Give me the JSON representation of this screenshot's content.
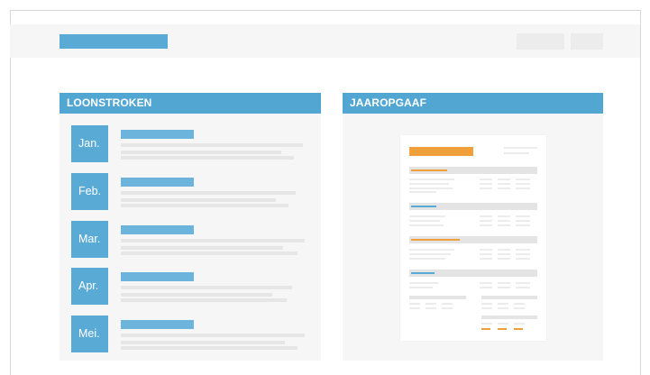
{
  "window": {
    "title": ""
  },
  "colors": {
    "accent": "#52a6d2",
    "doc_highlight": "#f0a03a",
    "panel_bg": "#f6f6f6"
  },
  "left_panel": {
    "title": "LOONSTROKEN",
    "months": [
      {
        "label": "Jan."
      },
      {
        "label": "Feb."
      },
      {
        "label": "Mar."
      },
      {
        "label": "Apr."
      },
      {
        "label": "Mei."
      }
    ]
  },
  "right_panel": {
    "title": "JAAROPGAAF",
    "document_preview": {
      "icon": "annual-statement-document"
    }
  }
}
